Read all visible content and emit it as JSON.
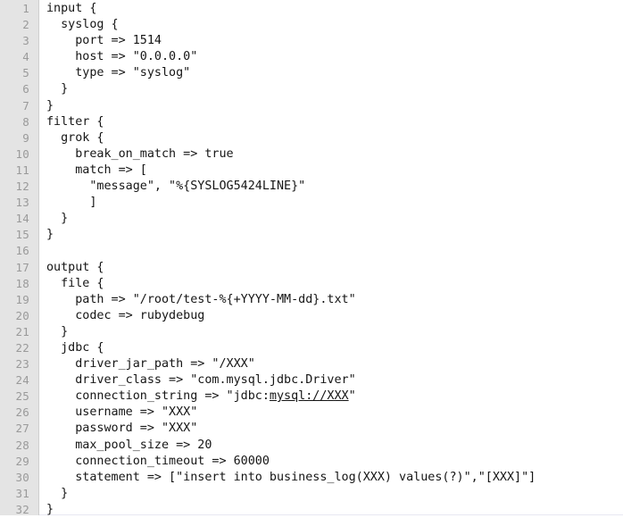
{
  "editor": {
    "language": "logstash-conf",
    "gutter_background": "#e4e4e4",
    "code_background": "#ffffff",
    "text_color": "#151515",
    "line_number_color": "#9a9a9a",
    "total_lines": 32
  },
  "lines": [
    {
      "num": "1",
      "text": "input {"
    },
    {
      "num": "2",
      "text": "  syslog {"
    },
    {
      "num": "3",
      "text": "    port => 1514"
    },
    {
      "num": "4",
      "text": "    host => \"0.0.0.0\""
    },
    {
      "num": "5",
      "text": "    type => \"syslog\""
    },
    {
      "num": "6",
      "text": "  }"
    },
    {
      "num": "7",
      "text": "}"
    },
    {
      "num": "8",
      "text": "filter {"
    },
    {
      "num": "9",
      "text": "  grok {"
    },
    {
      "num": "10",
      "text": "    break_on_match => true"
    },
    {
      "num": "11",
      "text": "    match => ["
    },
    {
      "num": "12",
      "text": "      \"message\", \"%{SYSLOG5424LINE}\""
    },
    {
      "num": "13",
      "text": "      ]"
    },
    {
      "num": "14",
      "text": "  }"
    },
    {
      "num": "15",
      "text": "}"
    },
    {
      "num": "16",
      "text": ""
    },
    {
      "num": "17",
      "text": "output {"
    },
    {
      "num": "18",
      "text": "  file {"
    },
    {
      "num": "19",
      "text": "    path => \"/root/test-%{+YYYY-MM-dd}.txt\""
    },
    {
      "num": "20",
      "text": "    codec => rubydebug"
    },
    {
      "num": "21",
      "text": "  }"
    },
    {
      "num": "22",
      "text": "  jdbc {"
    },
    {
      "num": "23",
      "text": "    driver_jar_path => \"/XXX\""
    },
    {
      "num": "24",
      "text": "    driver_class => \"com.mysql.jdbc.Driver\""
    },
    {
      "num": "25",
      "text": "    connection_string => \"jdbc:mysql://XXX\"",
      "link": {
        "prefix": "    connection_string => \"jdbc:",
        "linked": "mysql://XXX",
        "suffix": "\""
      }
    },
    {
      "num": "26",
      "text": "    username => \"XXX\""
    },
    {
      "num": "27",
      "text": "    password => \"XXX\""
    },
    {
      "num": "28",
      "text": "    max_pool_size => 20"
    },
    {
      "num": "29",
      "text": "    connection_timeout => 60000"
    },
    {
      "num": "30",
      "text": "    statement => [\"insert into business_log(XXX) values(?)\",\"[XXX]\"]"
    },
    {
      "num": "31",
      "text": "  }"
    },
    {
      "num": "32",
      "text": "}"
    }
  ]
}
